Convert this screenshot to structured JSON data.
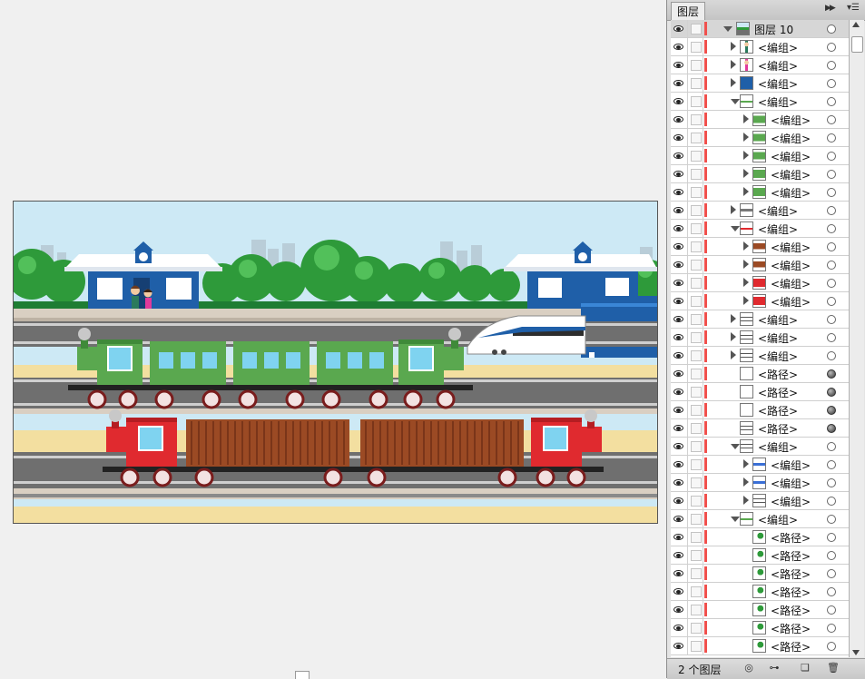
{
  "panel": {
    "tab_label": "图层",
    "layer_count": "2 个图层",
    "icons": [
      "collapse-icon",
      "panel-menu-icon",
      "make-clipping-mask-icon",
      "create-sublayer-icon",
      "create-layer-icon",
      "delete-icon"
    ]
  },
  "layers": [
    {
      "name": "图层 10",
      "indent": 0,
      "toggle": "open",
      "thumb": "scene",
      "target": "hollow",
      "top": true
    },
    {
      "name": "<编组>",
      "indent": 1,
      "toggle": "closed",
      "thumb": "person-dark",
      "target": "hollow"
    },
    {
      "name": "<编组>",
      "indent": 1,
      "toggle": "closed",
      "thumb": "person-pink",
      "target": "hollow"
    },
    {
      "name": "<编组>",
      "indent": 1,
      "toggle": "closed",
      "thumb": "blue-block",
      "target": "hollow"
    },
    {
      "name": "<编组>",
      "indent": 1,
      "toggle": "open",
      "thumb": "green-line",
      "target": "hollow"
    },
    {
      "name": "<编组>",
      "indent": 2,
      "toggle": "closed",
      "thumb": "green-car",
      "target": "hollow"
    },
    {
      "name": "<编组>",
      "indent": 2,
      "toggle": "closed",
      "thumb": "green-car",
      "target": "hollow"
    },
    {
      "name": "<编组>",
      "indent": 2,
      "toggle": "closed",
      "thumb": "green-car",
      "target": "hollow"
    },
    {
      "name": "<编组>",
      "indent": 2,
      "toggle": "closed",
      "thumb": "green-engine",
      "target": "hollow"
    },
    {
      "name": "<编组>",
      "indent": 2,
      "toggle": "closed",
      "thumb": "green-engine",
      "target": "hollow"
    },
    {
      "name": "<编组>",
      "indent": 1,
      "toggle": "closed",
      "thumb": "gray-track",
      "target": "hollow"
    },
    {
      "name": "<编组>",
      "indent": 1,
      "toggle": "open",
      "thumb": "red-line",
      "target": "hollow"
    },
    {
      "name": "<编组>",
      "indent": 2,
      "toggle": "closed",
      "thumb": "brown-car",
      "target": "hollow"
    },
    {
      "name": "<编组>",
      "indent": 2,
      "toggle": "closed",
      "thumb": "brown-car",
      "target": "hollow"
    },
    {
      "name": "<编组>",
      "indent": 2,
      "toggle": "closed",
      "thumb": "red-engine",
      "target": "hollow"
    },
    {
      "name": "<编组>",
      "indent": 2,
      "toggle": "closed",
      "thumb": "red-engine",
      "target": "hollow"
    },
    {
      "name": "<编组>",
      "indent": 1,
      "toggle": "closed",
      "thumb": "lines",
      "target": "hollow"
    },
    {
      "name": "<编组>",
      "indent": 1,
      "toggle": "closed",
      "thumb": "lines",
      "target": "hollow"
    },
    {
      "name": "<编组>",
      "indent": 1,
      "toggle": "closed",
      "thumb": "lines",
      "target": "hollow"
    },
    {
      "name": "<路径>",
      "indent": 1,
      "toggle": "none",
      "thumb": "blank",
      "target": "filled"
    },
    {
      "name": "<路径>",
      "indent": 1,
      "toggle": "none",
      "thumb": "blank",
      "target": "filled"
    },
    {
      "name": "<路径>",
      "indent": 1,
      "toggle": "none",
      "thumb": "blank",
      "target": "filled"
    },
    {
      "name": "<路径>",
      "indent": 1,
      "toggle": "none",
      "thumb": "lines",
      "target": "filled"
    },
    {
      "name": "<编组>",
      "indent": 1,
      "toggle": "open",
      "thumb": "lines",
      "target": "hollow"
    },
    {
      "name": "<编组>",
      "indent": 2,
      "toggle": "closed",
      "thumb": "blue-marks",
      "target": "hollow"
    },
    {
      "name": "<编组>",
      "indent": 2,
      "toggle": "closed",
      "thumb": "blue-marks",
      "target": "hollow"
    },
    {
      "name": "<编组>",
      "indent": 2,
      "toggle": "closed",
      "thumb": "lines",
      "target": "hollow"
    },
    {
      "name": "<编组>",
      "indent": 1,
      "toggle": "open",
      "thumb": "green-line",
      "target": "hollow"
    },
    {
      "name": "<路径>",
      "indent": 3,
      "toggle": "none",
      "thumb": "leaf",
      "target": "hollow"
    },
    {
      "name": "<路径>",
      "indent": 3,
      "toggle": "none",
      "thumb": "leaf",
      "target": "hollow"
    },
    {
      "name": "<路径>",
      "indent": 3,
      "toggle": "none",
      "thumb": "leaf",
      "target": "hollow"
    },
    {
      "name": "<路径>",
      "indent": 3,
      "toggle": "none",
      "thumb": "leaf",
      "target": "hollow"
    },
    {
      "name": "<路径>",
      "indent": 3,
      "toggle": "none",
      "thumb": "leaf",
      "target": "hollow"
    },
    {
      "name": "<路径>",
      "indent": 3,
      "toggle": "none",
      "thumb": "leaf",
      "target": "hollow"
    },
    {
      "name": "<路径>",
      "indent": 3,
      "toggle": "none",
      "thumb": "leaf",
      "target": "hollow"
    }
  ],
  "colors": {
    "layer_color": "#f0504d",
    "sky": "#cde9f5",
    "station_blue": "#1f5fa8",
    "tree_green": "#2e9a3a",
    "green_train": "#5aa84f",
    "red_train": "#e02a2f",
    "cargo_brown": "#9b4a24"
  }
}
